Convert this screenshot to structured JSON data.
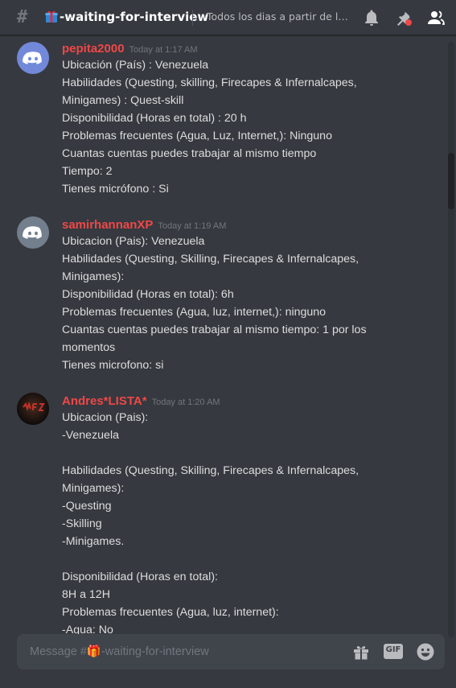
{
  "header": {
    "hash": "#",
    "channel_name": "-waiting-for-interview",
    "topic": "Todos los dias a partir de las …"
  },
  "messages": [
    {
      "author": "pepita2000",
      "timestamp": "Today at 1:17 AM",
      "avatar": "discord-default-avatar-blurple",
      "lines": [
        "Ubicación (País) : Venezuela",
        "Habilidades (Questing, skilling, Firecapes & Infernalcapes,",
        "Minigames) : Quest-skill",
        "Disponibilidad (Horas en total) : 20 h",
        "Problemas frecuentes (Agua, Luz, Internet,): Ninguno",
        "Cuantas cuentas puedes trabajar al mismo tiempo",
        "Tiempo: 2",
        "Tienes micrófono : Si"
      ]
    },
    {
      "author": "samirhannanXP",
      "timestamp": "Today at 1:19 AM",
      "avatar": "discord-default-avatar-grey",
      "lines": [
        "Ubicacion (Pais): Venezuela",
        "Habilidades (Questing, Skilling, Firecapes & Infernalcapes,",
        "Minigames):",
        "Disponibilidad (Horas en total): 6h",
        "Problemas frecuentes (Agua, luz, internet,): ninguno",
        "Cuantas cuentas puedes trabajar al mismo tiempo: 1 por los",
        "momentos",
        "Tienes microfono: si"
      ]
    },
    {
      "author": "Andres*LISTA*",
      "timestamp": "Today at 1:20 AM",
      "avatar": "custom-dark-avatar",
      "lines": [
        "Ubicacion (Pais):",
        "-Venezuela",
        "",
        "Habilidades (Questing, Skilling, Firecapes & Infernalcapes,",
        "Minigames):",
        "-Questing",
        "-Skilling",
        "-Minigames.",
        "",
        "Disponibilidad (Horas en total):",
        "8H a 12H",
        "Problemas frecuentes (Agua, luz, internet):",
        "-Agua: No"
      ]
    }
  ],
  "composer": {
    "placeholder": "Message #🎁-waiting-for-interview",
    "gif_label": "GIF"
  },
  "colors": {
    "background": "#36393f",
    "author": "#f04747",
    "text": "#dcddde",
    "muted": "#72767d",
    "blurple": "#7289da",
    "composer": "#40444b"
  }
}
